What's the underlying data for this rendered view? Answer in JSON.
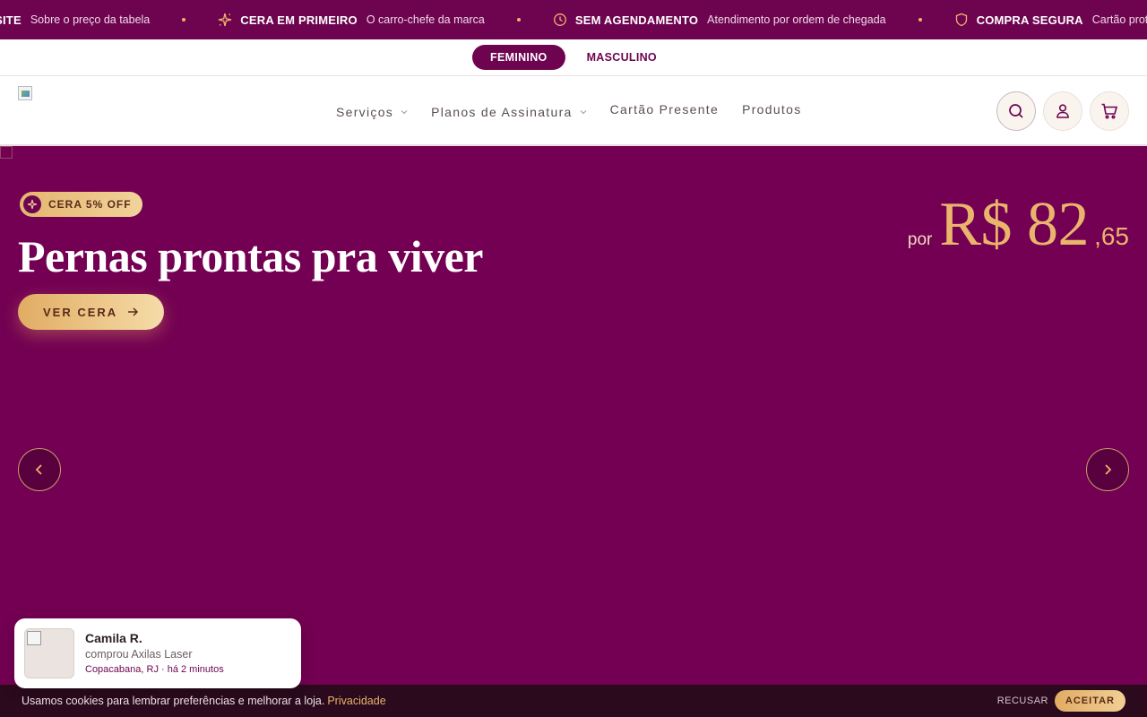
{
  "ticker": {
    "items": [
      {
        "title": "O SITE",
        "subtitle": "Sobre o preço da tabela",
        "icon": "tag-icon"
      },
      {
        "title": "CERA EM PRIMEIRO",
        "subtitle": "O carro-chefe da marca",
        "icon": "sparkle-icon"
      },
      {
        "title": "SEM AGENDAMENTO",
        "subtitle": "Atendimento por ordem de chegada",
        "icon": "clock-icon"
      },
      {
        "title": "COMPRA SEGURA",
        "subtitle": "Cartão protegido",
        "icon": "shield-icon"
      }
    ]
  },
  "gender": {
    "female": "FEMININO",
    "male": "MASCULINO",
    "selected": "FEMININO"
  },
  "nav": {
    "menu": [
      {
        "label": "Serviços",
        "has_dropdown": true
      },
      {
        "label": "Planos de Assinatura",
        "has_dropdown": true
      },
      {
        "label": "Cartão Presente",
        "has_dropdown": false
      },
      {
        "label": "Produtos",
        "has_dropdown": false
      }
    ],
    "icons": [
      "search-icon",
      "user-icon",
      "cart-icon"
    ]
  },
  "hero": {
    "badge": "CERA 5% OFF",
    "title": "Pernas prontas pra viver",
    "cta": "VER CERA",
    "price_prefix": "por",
    "price_main": "R$ 82",
    "price_cents": ",65"
  },
  "toast": {
    "name": "Camila R.",
    "description": "comprou Axilas Laser",
    "meta": "Copacabana, RJ · há 2 minutos"
  },
  "cookie": {
    "text": "Usamos cookies para lembrar preferências e melhorar a loja.",
    "link": "Privacidade",
    "refuse": "RECUSAR",
    "accept": "ACEITAR"
  },
  "colors": {
    "brand": "#730052",
    "gold": "#e9b46c",
    "cookie_bg": "#2a0a1c"
  }
}
